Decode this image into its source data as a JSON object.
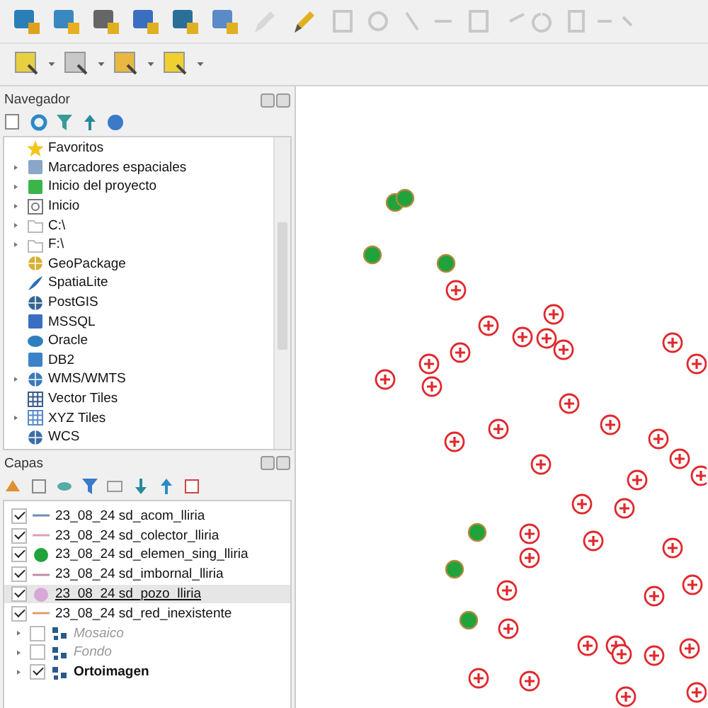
{
  "browser": {
    "title": "Navegador",
    "items": [
      {
        "label": "Favoritos",
        "kind": "favorites",
        "expandable": false
      },
      {
        "label": "Marcadores espaciales",
        "kind": "bookmarks",
        "expandable": true
      },
      {
        "label": "Inicio del proyecto",
        "kind": "project",
        "expandable": true
      },
      {
        "label": "Inicio",
        "kind": "home",
        "expandable": true
      },
      {
        "label": "C:\\",
        "kind": "folder",
        "expandable": true
      },
      {
        "label": "F:\\",
        "kind": "folder",
        "expandable": true
      },
      {
        "label": "GeoPackage",
        "kind": "geopackage",
        "expandable": false
      },
      {
        "label": "SpatiaLite",
        "kind": "spatialite",
        "expandable": false
      },
      {
        "label": "PostGIS",
        "kind": "postgis",
        "expandable": false
      },
      {
        "label": "MSSQL",
        "kind": "mssql",
        "expandable": false
      },
      {
        "label": "Oracle",
        "kind": "oracle",
        "expandable": false
      },
      {
        "label": "DB2",
        "kind": "db2",
        "expandable": false
      },
      {
        "label": "WMS/WMTS",
        "kind": "wms",
        "expandable": true
      },
      {
        "label": "Vector Tiles",
        "kind": "vectortiles",
        "expandable": false
      },
      {
        "label": "XYZ Tiles",
        "kind": "xyz",
        "expandable": true
      },
      {
        "label": "WCS",
        "kind": "wcs",
        "expandable": false
      }
    ]
  },
  "layers": {
    "title": "Capas",
    "items": [
      {
        "label": "23_08_24 sd_acom_lliria",
        "kind": "line",
        "checked": true,
        "selected": false,
        "color": "#6a8fb0"
      },
      {
        "label": "23_08_24 sd_colector_lliria",
        "kind": "line",
        "checked": true,
        "selected": false,
        "color": "#e0a0b0"
      },
      {
        "label": "23_08_24 sd_elemen_sing_lliria",
        "kind": "point",
        "checked": true,
        "selected": false,
        "color": "#1fa33a"
      },
      {
        "label": "23_08_24 sd_imbornal_lliria",
        "kind": "line",
        "checked": true,
        "selected": false,
        "color": "#c090a0"
      },
      {
        "label": "23_08_24 sd_pozo_lliria",
        "kind": "point",
        "checked": true,
        "selected": true,
        "color": "#d8a8d8"
      },
      {
        "label": "23_08_24 sd_red_inexistente",
        "kind": "line",
        "checked": true,
        "selected": false,
        "color": "#d8a070"
      },
      {
        "label": "Mosaico",
        "kind": "group",
        "checked": false,
        "selected": false
      },
      {
        "label": "Fondo",
        "kind": "group",
        "checked": false,
        "selected": false
      },
      {
        "label": "Ortoimagen",
        "kind": "group",
        "checked": true,
        "selected": false
      }
    ]
  }
}
